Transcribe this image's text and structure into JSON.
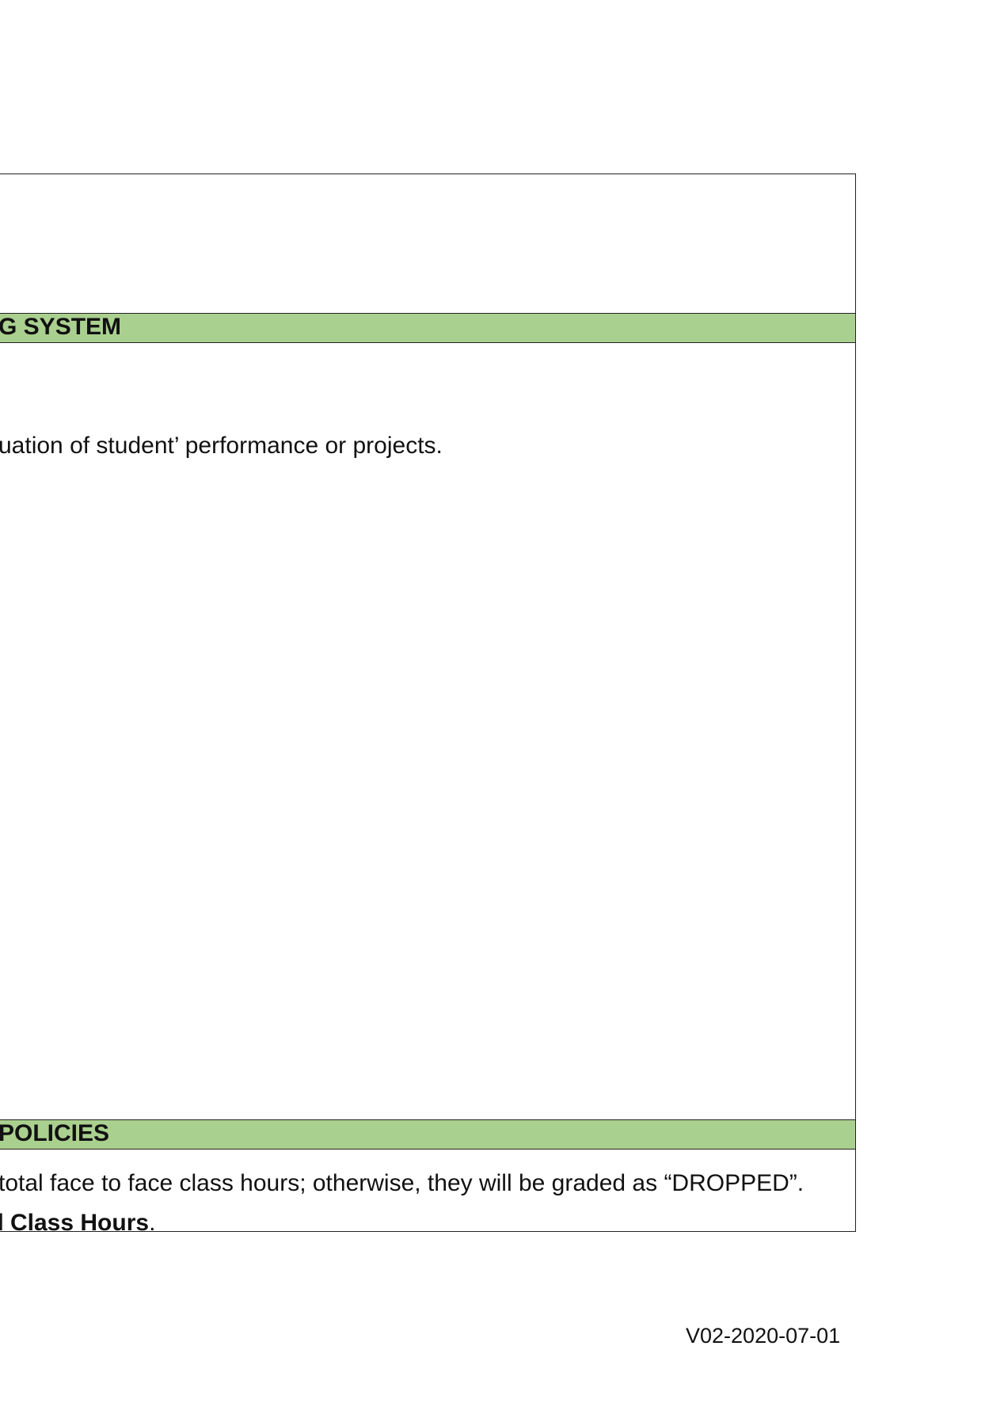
{
  "sections": {
    "evaluation_text": "uation of student’ performance or projects.",
    "grading_header": "G SYSTEM",
    "class_hours": {
      "prefix": "l ",
      "bold": "Class Hours",
      "suffix": "."
    },
    "policies_header": "POLICIES",
    "policies_text": " total face to face class hours; otherwise, they will be graded as “DROPPED”."
  },
  "footer": {
    "version": "V02-2020-07-01"
  },
  "colors": {
    "band": "#aad08f",
    "border": "#222222"
  }
}
